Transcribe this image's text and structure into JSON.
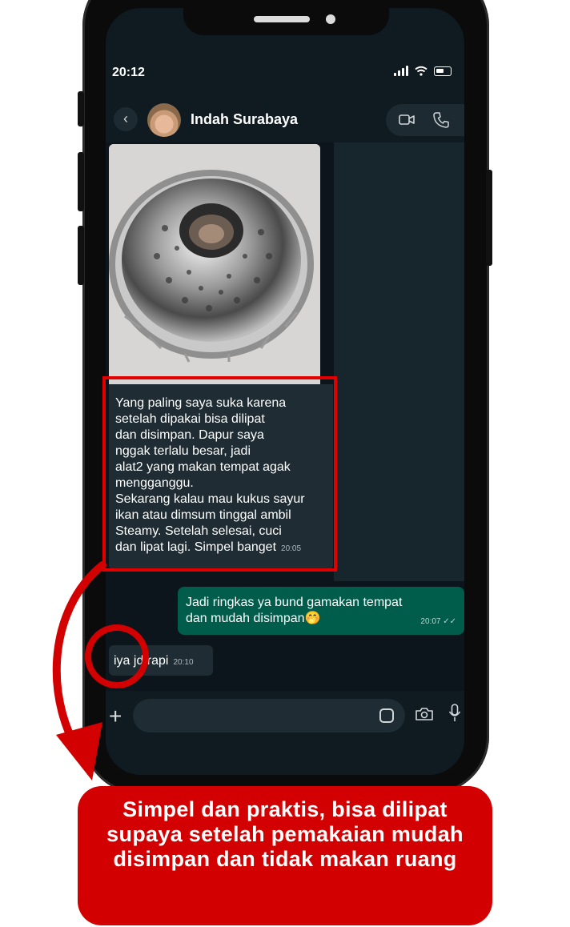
{
  "status_bar": {
    "time": "20:12"
  },
  "header": {
    "contact_name": "Indah Surabaya"
  },
  "messages": [
    {
      "type": "incoming_image_caption",
      "lines": [
        "Yang paling saya suka karena",
        "setelah dipakai bisa dilipat",
        "dan disimpan. Dapur saya",
        "nggak terlalu besar, jadi",
        "alat2 yang makan tempat agak",
        "mengganggu.",
        "Sekarang kalau mau kukus sayur",
        "ikan atau dimsum tinggal ambil",
        "Steamy. Setelah selesai, cuci",
        "dan lipat lagi. Simpel banget"
      ],
      "time": "20:05"
    },
    {
      "type": "outgoing",
      "lines": [
        "Jadi ringkas ya bund gamakan tempat",
        "dan mudah disimpan"
      ],
      "emoji": "🤭",
      "time": "20:07"
    },
    {
      "type": "incoming",
      "text": "iya jd rapi",
      "time": "20:10"
    }
  ],
  "banner": {
    "text": "Simpel dan praktis, bisa dilipat supaya setelah pemakaian mudah disimpan dan tidak makan ruang"
  },
  "colors": {
    "accent_red": "#d20000",
    "outgoing_bubble": "#005c4b",
    "incoming_bubble": "#1f2c33"
  }
}
